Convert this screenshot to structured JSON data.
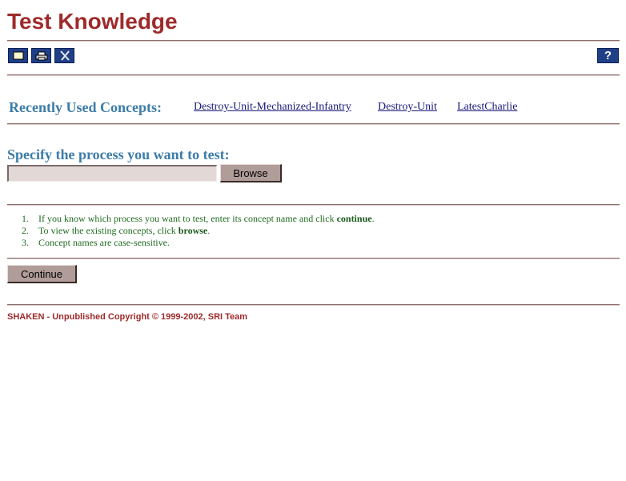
{
  "page": {
    "title": "Test Knowledge"
  },
  "toolbar": {
    "buttons": [
      {
        "icon": "window-icon"
      },
      {
        "icon": "print-icon"
      },
      {
        "icon": "tools-icon"
      }
    ],
    "help_label": "?"
  },
  "recent": {
    "label": "Recently Used Concepts:",
    "links": [
      "Destroy-Unit-Mechanized-Infantry",
      "Destroy-Unit",
      "LatestCharlie"
    ]
  },
  "specify": {
    "label": "Specify the process you want to test:",
    "input_value": "",
    "browse_label": "Browse"
  },
  "instructions": [
    {
      "num": "1.",
      "pre": "If you know which process you want to test, enter its concept name and click ",
      "bold": "continue",
      "post": "."
    },
    {
      "num": "2.",
      "pre": "To view the existing concepts, click ",
      "bold": "browse",
      "post": "."
    },
    {
      "num": "3.",
      "pre": "Concept names are case-sensitive.",
      "bold": "",
      "post": ""
    }
  ],
  "continue_label": "Continue",
  "footer": "SHAKEN - Unpublished Copyright © 1999-2002, SRI Team",
  "colors": {
    "title": "#9e2a2b",
    "heading": "#3d7ca8",
    "instructions": "#1f6b1f",
    "toolbar_button": "#1f3f86",
    "button_face": "#b09c99"
  }
}
